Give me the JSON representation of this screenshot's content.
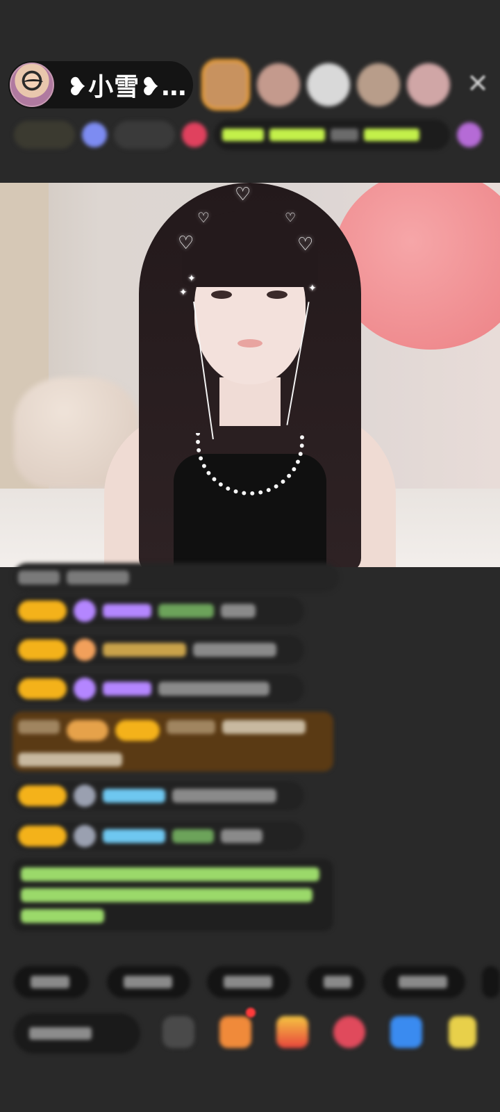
{
  "header": {
    "host_name": "❥小雪❥…",
    "close_icon": "close-icon",
    "viewer_avatar_colors": [
      "#c8925f",
      "#c49a8d",
      "#d9d9d9",
      "#b89d8a",
      "#d0a6a6"
    ]
  },
  "status_row": {
    "accent_colors": [
      "#e8d27a",
      "#7d8cf2",
      "#e0415e",
      "#c3f04a",
      "#b56bd6"
    ]
  },
  "chat": {
    "badge_color": "#f4b21a",
    "name_colors": [
      "#b486ff",
      "#f2c06b",
      "#6ec7f0"
    ],
    "system_text_color": "#9bd96a",
    "highlight_bg": "#5a3a14"
  },
  "bottom": {
    "chip_count": 6,
    "icons": [
      "emoji-icon",
      "gift-box-icon",
      "treasure-icon",
      "heart-icon",
      "game-icon",
      "grid-icon"
    ]
  }
}
